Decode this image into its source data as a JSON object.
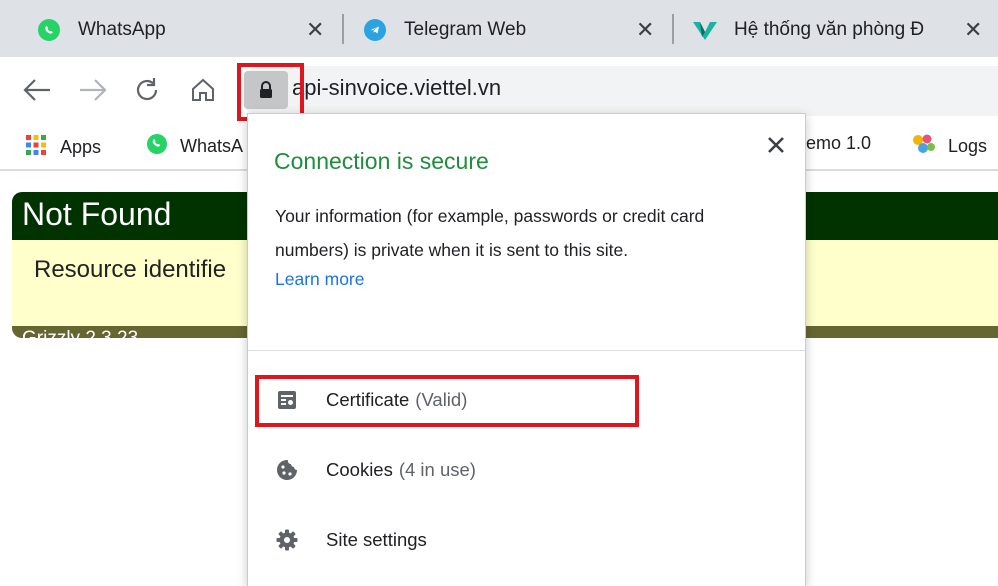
{
  "tabs": [
    {
      "title": "WhatsApp",
      "icon": "whatsapp-icon",
      "color": "#25d366"
    },
    {
      "title": "Telegram Web",
      "icon": "telegram-icon",
      "color": "#2aa3e0"
    },
    {
      "title": "Hệ thống văn phòng Đ",
      "icon": "vtrack-icon",
      "color": "#1bb3a0"
    }
  ],
  "toolbar": {
    "url": "api-sinvoice.viettel.vn"
  },
  "bookmarks": [
    {
      "label": "Apps",
      "icon": "apps-grid-icon"
    },
    {
      "label": "WhatsA",
      "icon": "whatsapp-icon"
    },
    {
      "label": "emo 1.0",
      "icon": ""
    },
    {
      "label": "Logs",
      "icon": "logs-icon"
    }
  ],
  "page": {
    "heading": "Not Found",
    "message": "Resource identifie",
    "footer": "Grizzly 2.3.23"
  },
  "popup": {
    "title": "Connection is secure",
    "description": "Your information (for example, passwords or credit card numbers) is private when it is sent to this site.",
    "learn_more": "Learn more",
    "items": [
      {
        "label": "Certificate",
        "sub": "(Valid)",
        "icon": "certificate-icon"
      },
      {
        "label": "Cookies",
        "sub": "(4 in use)",
        "icon": "cookie-icon"
      },
      {
        "label": "Site settings",
        "sub": "",
        "icon": "gear-icon"
      }
    ]
  },
  "colors": {
    "secure_green": "#1e8e3e",
    "link_blue": "#1a73e8",
    "highlight_red": "#e0161e",
    "error_header": "#003300",
    "error_body": "#ffffcc",
    "error_footer": "#666633"
  }
}
